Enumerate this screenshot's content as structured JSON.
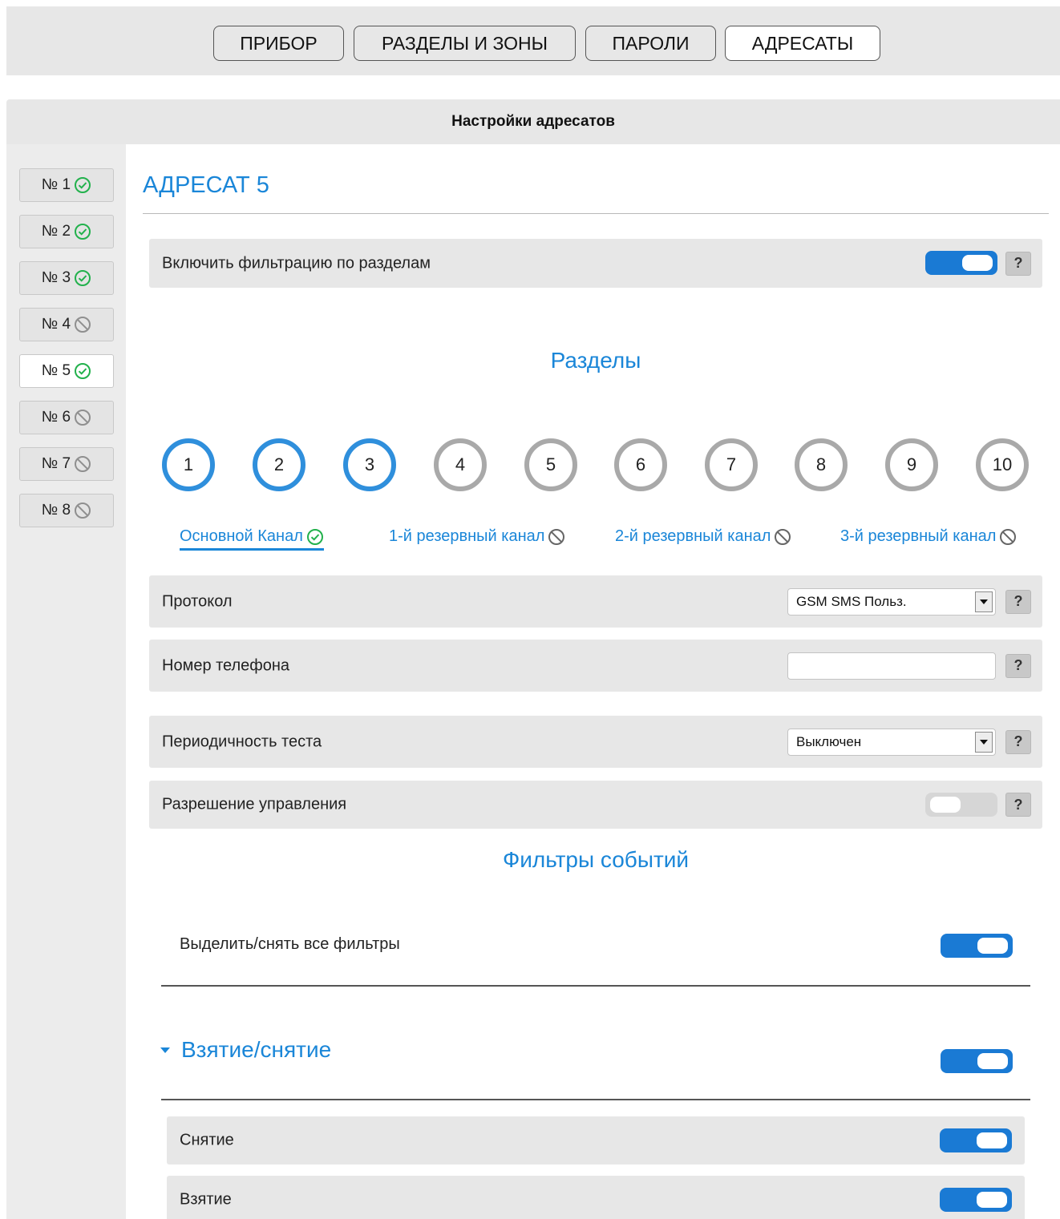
{
  "nav": {
    "items": [
      "ПРИБОР",
      "РАЗДЕЛЫ И ЗОНЫ",
      "ПАРОЛИ",
      "АДРЕСАТЫ"
    ],
    "active_index": 3
  },
  "panel": {
    "title": "Настройки адресатов"
  },
  "sidebar": {
    "items": [
      {
        "label": "№ 1",
        "status": "enabled"
      },
      {
        "label": "№ 2",
        "status": "enabled"
      },
      {
        "label": "№ 3",
        "status": "enabled"
      },
      {
        "label": "№ 4",
        "status": "disabled"
      },
      {
        "label": "№ 5",
        "status": "enabled",
        "active": true
      },
      {
        "label": "№ 6",
        "status": "disabled"
      },
      {
        "label": "№ 7",
        "status": "disabled"
      },
      {
        "label": "№ 8",
        "status": "disabled"
      }
    ]
  },
  "main": {
    "title": "АДРЕСАТ 5",
    "filter_by_partitions": {
      "label": "Включить фильтрацию по разделам",
      "on": true,
      "help": "?"
    },
    "partitions_title": "Разделы",
    "partitions": [
      {
        "number": "1",
        "selected": true
      },
      {
        "number": "2",
        "selected": true
      },
      {
        "number": "3",
        "selected": true
      },
      {
        "number": "4",
        "selected": false
      },
      {
        "number": "5",
        "selected": false
      },
      {
        "number": "6",
        "selected": false
      },
      {
        "number": "7",
        "selected": false
      },
      {
        "number": "8",
        "selected": false
      },
      {
        "number": "9",
        "selected": false
      },
      {
        "number": "10",
        "selected": false
      }
    ],
    "channels": [
      {
        "label": "Основной Канал",
        "status": "enabled",
        "active": true
      },
      {
        "label": "1-й резервный канал",
        "status": "disabled"
      },
      {
        "label": "2-й резервный канал",
        "status": "disabled"
      },
      {
        "label": "3-й резервный канал",
        "status": "disabled"
      }
    ],
    "protocol": {
      "label": "Протокол",
      "value": "GSM SMS Польз.",
      "help": "?"
    },
    "phone": {
      "label": "Номер телефона",
      "value": "",
      "help": "?"
    },
    "test_period": {
      "label": "Периодичность теста",
      "value": "Выключен",
      "help": "?"
    },
    "control_permission": {
      "label": "Разрешение управления",
      "on": false,
      "help": "?"
    },
    "event_filters_title": "Фильтры событий",
    "select_all": {
      "label": "Выделить/снять все фильтры",
      "on": true
    },
    "group": {
      "title": "Взятие/снятие",
      "on": true,
      "items": [
        {
          "label": "Снятие",
          "on": true
        },
        {
          "label": "Взятие",
          "on": true
        }
      ]
    }
  },
  "colors": {
    "accent": "#1a86d8",
    "toggle_on": "#1a7ad4",
    "ok": "#22b14c",
    "disabled": "#8f8f8f"
  }
}
